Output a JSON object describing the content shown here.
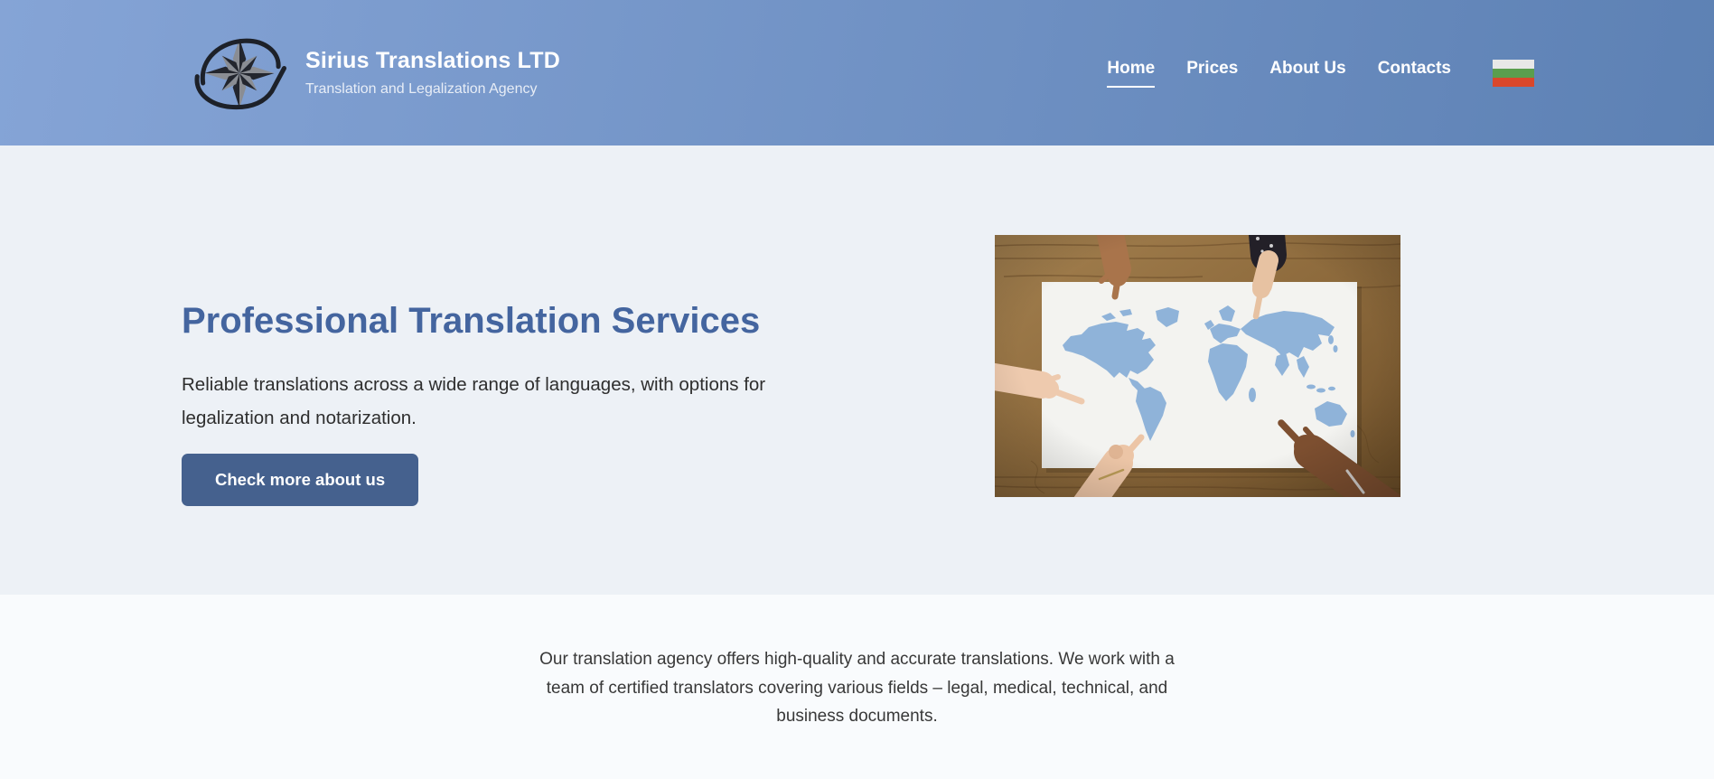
{
  "brand": {
    "title": "Sirius Translations LTD",
    "subtitle": "Translation and Legalization Agency",
    "logo_icon": "compass-orbit-logo"
  },
  "nav": {
    "items": [
      {
        "label": "Home",
        "active": true
      },
      {
        "label": "Prices",
        "active": false
      },
      {
        "label": "About Us",
        "active": false
      },
      {
        "label": "Contacts",
        "active": false
      }
    ],
    "language_flag": "bulgaria-flag"
  },
  "hero": {
    "heading": "Professional Translation Services",
    "description": [
      "Reliable translations across a wide range of languages, with options for",
      "legalization and notarization."
    ],
    "cta_label": "Check more about us",
    "image_description": "hands pointing at world map on wooden table"
  },
  "about": {
    "lines": [
      "Our translation agency offers high-quality and accurate translations. We work with a",
      "team of certified translators covering various fields – legal, medical, technical, and",
      "business documents."
    ]
  },
  "colors": {
    "header-grad-start": "#85a4d6",
    "header-grad-end": "#5d81b4",
    "hero-bg": "#edf1f6",
    "footer-bg": "#f9fbfd",
    "heading": "#44659f",
    "button-bg": "#45618e",
    "flag-white": "#e8e8e8",
    "flag-green": "#5a9e4e",
    "flag-red": "#d9472b",
    "map-blue": "#8fb3d9"
  }
}
